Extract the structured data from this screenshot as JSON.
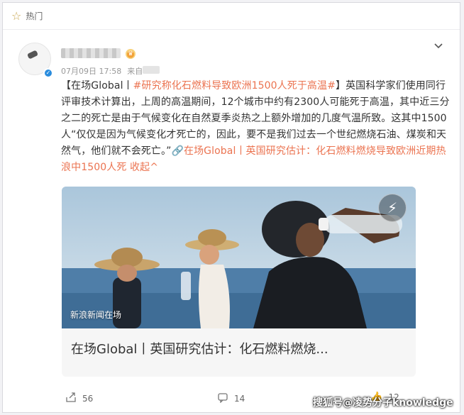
{
  "hot_bar": {
    "star_icon": "star-outline-icon",
    "label": "热门"
  },
  "post": {
    "time": "07月09日 17:58",
    "source_prefix": "来自",
    "body": {
      "lead": "【在场Global丨",
      "hashtag": "#研究称化石燃料导致欧洲1500人死于高温#",
      "text": "】英国科学家们使用同行评审技术计算出，上周的高温期间，12个城市中约有2300人可能死于高温，其中近三分之二的死亡是由于气候变化在自然夏季炎热之上额外增加的几度气温所致。这其中1500人“仅仅是因为气候变化才死亡的，因此，要不是我们过去一个世纪燃烧石油、煤炭和天然气，他们就不会死亡。”",
      "link_text": "🔗在场Global丨英国研究估计：化石燃料燃烧导致欧洲近期热浪中1500人死",
      "collapse": "收起^"
    },
    "card": {
      "source_tag": "新浪新闻在场",
      "title": "在场Global丨英国研究估计：化石燃料燃烧..."
    },
    "actions": {
      "share_count": "56",
      "comment_count": "14",
      "like_count": "12"
    }
  },
  "watermark": "搜狐号@凌势分子knowledge"
}
